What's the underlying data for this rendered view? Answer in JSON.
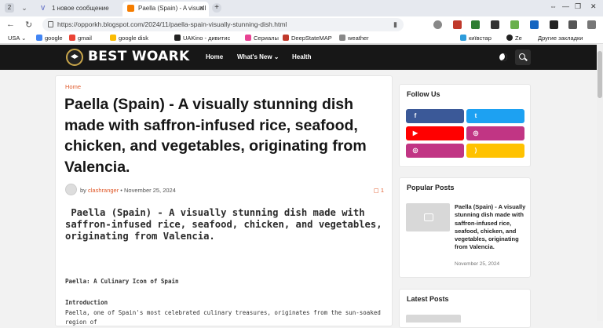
{
  "browser": {
    "tab_count": "2",
    "tabs": [
      {
        "label": "1 новое сообщение"
      },
      {
        "label": "Paella (Spain) - A visuall"
      }
    ],
    "url": "https://opporkh.blogspot.com/2024/11/paella-spain-visually-stunning-dish.html"
  },
  "bookmarks": [
    {
      "label": "USA"
    },
    {
      "label": "google"
    },
    {
      "label": "gmail"
    },
    {
      "label": "google disk"
    },
    {
      "label": "UAKino - дивитис"
    },
    {
      "label": "Сериалы"
    },
    {
      "label": "DeepStateMAP"
    },
    {
      "label": "weather"
    },
    {
      "label": "київстар"
    },
    {
      "label": "Ze"
    },
    {
      "label": "Другие закладки"
    }
  ],
  "site": {
    "logo": "BEST WOARK",
    "nav": [
      "Home",
      "What's New",
      "Health"
    ]
  },
  "post": {
    "breadcrumb": "Home",
    "title": "Paella (Spain) - A visually stunning dish made with saffron-infused rice, seafood, chicken, and vegetables, originating from Valencia.",
    "author_prefix": "by",
    "author": "clashranger",
    "date": "November 25, 2024",
    "comments": "1",
    "lead": "Paella (Spain) - A visually stunning dish made with saffron-infused rice, seafood, chicken, and vegetables, originating from Valencia.",
    "section1": "Paella: A Culinary Icon of Spain",
    "section2": "Introduction",
    "body": "Paella, one of Spain's most celebrated culinary treasures, originates from the sun-soaked region of"
  },
  "sidebar": {
    "follow_title": "Follow Us",
    "popular_title": "Popular Posts",
    "popular_post_title": "Paella (Spain) - A visually stunning dish made with saffron-infused rice, seafood, chicken, and vegetables, originating from Valencia.",
    "popular_post_date": "November 25, 2024",
    "latest_title": "Latest Posts"
  },
  "colors": {
    "facebook": "#3b5998",
    "twitter": "#1da1f2",
    "youtube": "#ff0000",
    "instagram": "#c13584",
    "rss": "#ffc200",
    "accent": "#e05a2b"
  },
  "icons": [
    "facebook-icon",
    "twitter-icon",
    "youtube-icon",
    "instagram-icon",
    "instagram-icon",
    "rss-icon"
  ]
}
